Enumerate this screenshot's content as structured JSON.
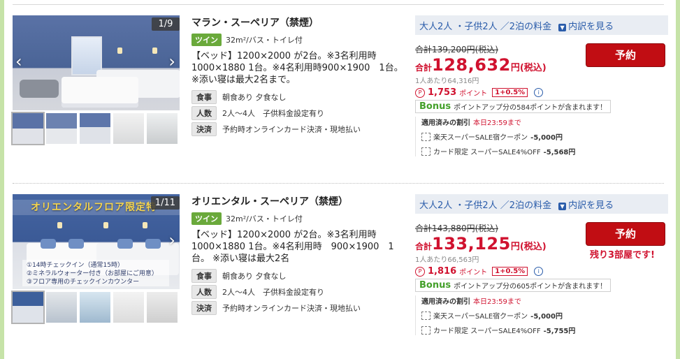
{
  "rooms": [
    {
      "counter": "1/9",
      "banner": "",
      "overlay_lines": [],
      "name": "マラン・スーペリア（禁煙）",
      "tag": "ツイン",
      "spec": "32m²/バス・トイレ付",
      "desc": "【ベッド】1200×2000 が2台。※3名利用時1000×1880 1台。※4名利用時900×1900　1台。※添い寝は最大2名まで。",
      "info": [
        {
          "label": "食事",
          "value": "朝食あり 夕食なし"
        },
        {
          "label": "人数",
          "value": "2人～4人　子供料金設定有り"
        },
        {
          "label": "決済",
          "value": "予約時オンラインカード決済・現地払い"
        }
      ],
      "price_head": "大人2人 ・子供2人 ／2泊の料金",
      "breakdown": "内訳を見る",
      "orig": "合計139,200円(税込)",
      "total_label": "合計",
      "total_amount": "128,632",
      "total_unit": "円(税込)",
      "per_person": "1人あたり64,316円",
      "points": "1,753",
      "points_word": "ポイント",
      "points_rate": "1+0.5%",
      "bonus_word": "Bonus",
      "bonus_text": "ポイントアップ分の584ポイントが含まれます！",
      "discount_title": "適用済みの割引",
      "deadline": "本日23:59まで",
      "discounts": [
        {
          "name": "楽天スーパーSALE宿クーポン",
          "value": "-5,000円"
        },
        {
          "name": "カード限定 スーパーSALE4%OFF",
          "value": "-5,568円"
        }
      ],
      "reserve": "予約",
      "remaining": ""
    },
    {
      "counter": "1/11",
      "banner": "オリエンタルフロア限定特",
      "overlay_lines": [
        "①14時チェックイン（通常15時）",
        "②ミネラルウォーター付き（お部屋にご用意）",
        "③フロア専用のチェックインカウンター"
      ],
      "name": "オリエンタル・スーペリア（禁煙）",
      "tag": "ツイン",
      "spec": "32m²/バス・トイレ付",
      "desc": "【ベッド】1200×2000 が2台。※3名利用時1000×1880 1台。※4名利用時　900×1900　1台。 ※添い寝は最大2名",
      "info": [
        {
          "label": "食事",
          "value": "朝食あり 夕食なし"
        },
        {
          "label": "人数",
          "value": "2人～4人　子供料金設定有り"
        },
        {
          "label": "決済",
          "value": "予約時オンラインカード決済・現地払い"
        }
      ],
      "price_head": "大人2人 ・子供2人 ／2泊の料金",
      "breakdown": "内訳を見る",
      "orig": "合計143,880円(税込)",
      "total_label": "合計",
      "total_amount": "133,125",
      "total_unit": "円(税込)",
      "per_person": "1人あたり66,563円",
      "points": "1,816",
      "points_word": "ポイント",
      "points_rate": "1+0.5%",
      "bonus_word": "Bonus",
      "bonus_text": "ポイントアップ分の605ポイントが含まれます！",
      "discount_title": "適用済みの割引",
      "deadline": "本日23:59まで",
      "discounts": [
        {
          "name": "楽天スーパーSALE宿クーポン",
          "value": "-5,000円"
        },
        {
          "name": "カード限定 スーパーSALE4%OFF",
          "value": "-5,755円"
        }
      ],
      "reserve": "予約",
      "remaining": "残り3部屋です!"
    }
  ],
  "icons": {
    "prev": "arrow-left-icon",
    "next": "arrow-right-icon",
    "point": "point-circle-icon",
    "info": "info-icon",
    "coupon": "coupon-icon",
    "breakdown": "breakdown-toggle-icon"
  },
  "colors": {
    "accent_red": "#d0122f",
    "reserve_bg": "#c10d13",
    "link_blue": "#2a5caa",
    "tag_green": "#6aa93b",
    "bonus_green": "#44a02a",
    "frame_green": "#c6e3a8"
  }
}
